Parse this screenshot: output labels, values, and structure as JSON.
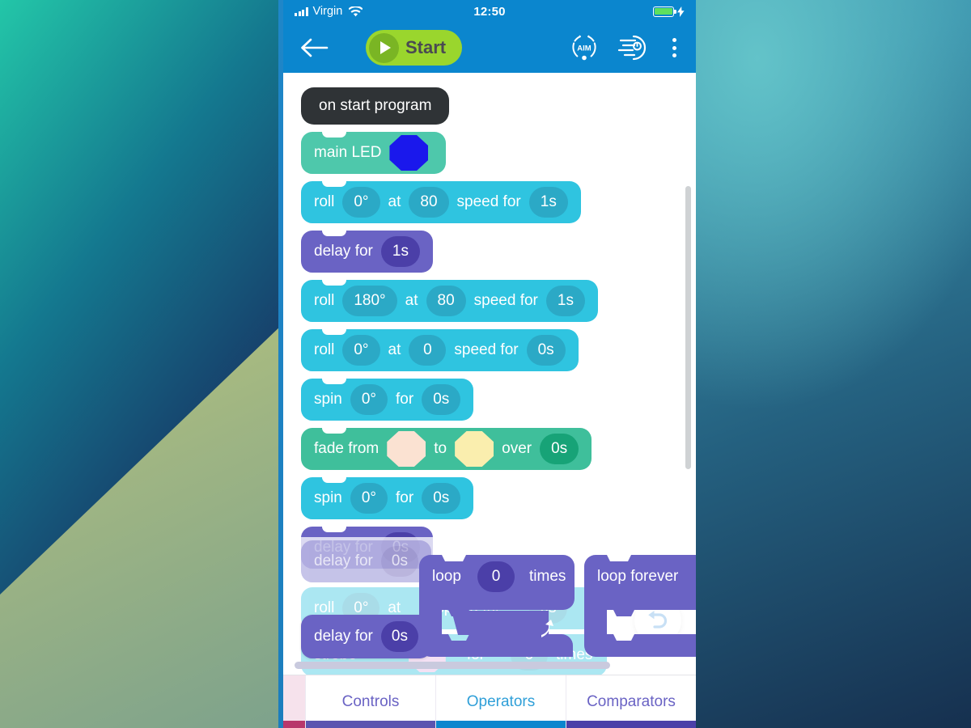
{
  "status_bar": {
    "carrier": "Virgin",
    "time": "12:50",
    "signal_icon": "signal-bars-icon",
    "wifi_icon": "wifi-icon",
    "battery_icon": "battery-charging-icon"
  },
  "navbar": {
    "back_icon": "back-arrow-icon",
    "start_label": "Start",
    "play_icon": "play-icon",
    "aim_label": "AIM",
    "aim_icon": "aim-icon",
    "sensors_icon": "sensor-data-icon",
    "overflow_icon": "more-vertical-icon"
  },
  "program": {
    "hat": {
      "label": "on start program"
    },
    "blocks": [
      {
        "type": "main-led",
        "label": "main LED",
        "color": "#1a18ec"
      },
      {
        "type": "roll",
        "label": "roll",
        "heading": "0°",
        "at": "at",
        "speed": "80",
        "speed_for": "speed for",
        "duration": "1s"
      },
      {
        "type": "delay",
        "label": "delay for",
        "duration": "1s"
      },
      {
        "type": "roll",
        "label": "roll",
        "heading": "180°",
        "at": "at",
        "speed": "80",
        "speed_for": "speed for",
        "duration": "1s"
      },
      {
        "type": "roll",
        "label": "roll",
        "heading": "0°",
        "at": "at",
        "speed": "0",
        "speed_for": "speed for",
        "duration": "0s"
      },
      {
        "type": "spin",
        "label": "spin",
        "heading": "0°",
        "for": "for",
        "duration": "0s"
      },
      {
        "type": "fade",
        "label": "fade from",
        "to": "to",
        "over": "over",
        "duration": "0s",
        "from_color": "#fbe2d2",
        "to_color": "#faeeae"
      },
      {
        "type": "spin",
        "label": "spin",
        "heading": "0°",
        "for": "for",
        "duration": "0s"
      },
      {
        "type": "delay",
        "label": "delay for",
        "duration": "0s"
      }
    ],
    "undo_icon": "undo-icon"
  },
  "palette": {
    "background_blocks": [
      {
        "label": "delay for",
        "value": "0s"
      },
      {
        "label": "roll",
        "value": "0°",
        "at": "at"
      },
      {
        "label": "strobe",
        "mid": "for",
        "value": "0",
        "unit": "times"
      },
      {
        "label": "speed for",
        "value": "0s"
      }
    ],
    "items": [
      {
        "name": "delay-for",
        "label": "delay for",
        "value": "0s"
      },
      {
        "name": "loop-times",
        "label": "loop",
        "value": "0",
        "suffix": "times",
        "loop_arrow_icon": "loop-arrow-icon"
      },
      {
        "name": "loop-forever",
        "label": "loop forever"
      }
    ]
  },
  "tabs": {
    "items": [
      {
        "label": "Controls",
        "color": "#5b54b0",
        "text_color": "#6a63c4",
        "active": false
      },
      {
        "label": "Operators",
        "color": "#0b86ce",
        "text_color": "#2f9fd8",
        "active": true
      },
      {
        "label": "Comparators",
        "color": "#4b3fa8",
        "text_color": "#6a63c4",
        "active": false
      }
    ],
    "partial_tab_color": "#b8376b"
  }
}
